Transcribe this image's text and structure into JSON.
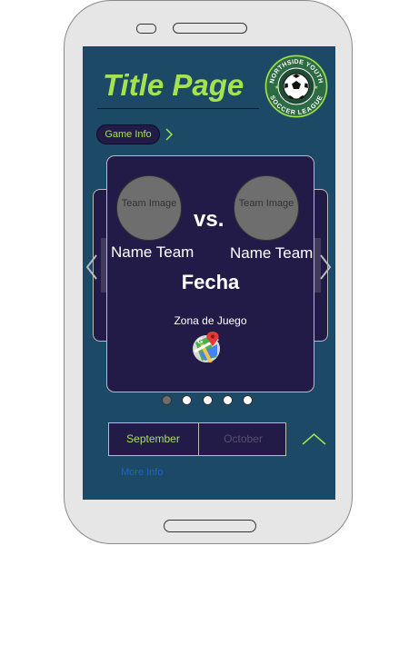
{
  "header": {
    "title": "Title Page",
    "logo_text_top": "NORTHSIDE YOUTH",
    "logo_text_bottom": "SOCCER LEAGUE"
  },
  "game_info": {
    "label": "Game Info"
  },
  "match": {
    "home_image_label": "Team Image",
    "away_image_label": "Team Image",
    "vs": "vs.",
    "home_name": "Name Team",
    "away_name": "Name Team",
    "date": "Fecha",
    "venue": "Zona de Juego"
  },
  "pagination": {
    "count": 5,
    "active_index": 0
  },
  "months": {
    "selected": "September",
    "other": "October"
  },
  "more_info": "More Info",
  "colors": {
    "screen_bg": "#1c4966",
    "card_bg": "#231b47",
    "accent": "#a4e34f",
    "link": "#1f64c6"
  },
  "icons": {
    "chip_arrow": "chevron-right-icon",
    "prev": "chevron-left-icon",
    "next": "chevron-right-icon",
    "map": "google-maps-icon",
    "collapse": "chevron-up-icon"
  }
}
